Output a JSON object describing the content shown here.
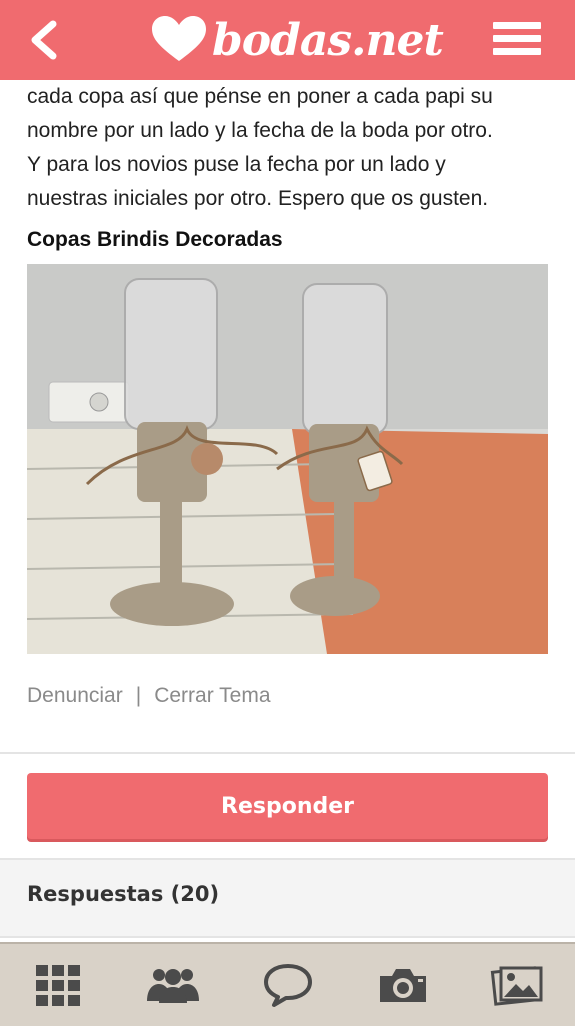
{
  "header": {
    "brand": "bodas.net",
    "back_icon": "chevron-left-icon",
    "menu_icon": "hamburger-menu-icon",
    "color": "#f06b6f"
  },
  "post": {
    "text": "cada copa así que pénse en poner a cada papi su\nnombre por un lado y la fecha de la boda por otro.\nY para los novios puse la fecha por un lado y\nnuestras iniciales por otro. Espero que os gusten.",
    "image_title": "Copas Brindis Decoradas"
  },
  "actions": {
    "report": "Denunciar",
    "separator": "|",
    "close": "Cerrar Tema"
  },
  "reply": {
    "button_label": "Responder"
  },
  "answers": {
    "title": "Respuestas (20)"
  },
  "tabbar": {
    "items": [
      {
        "icon": "grid-icon"
      },
      {
        "icon": "people-icon"
      },
      {
        "icon": "chat-bubble-icon"
      },
      {
        "icon": "camera-icon"
      },
      {
        "icon": "photos-icon"
      }
    ]
  }
}
